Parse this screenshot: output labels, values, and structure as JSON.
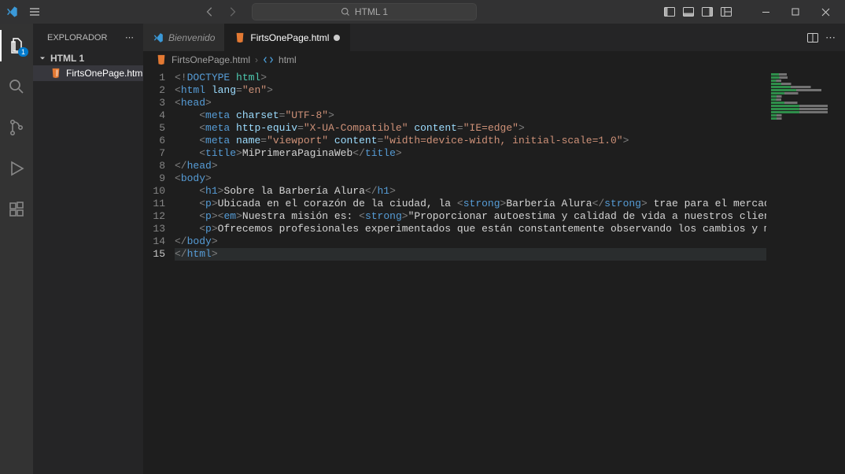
{
  "titlebar": {
    "search_placeholder": "HTML 1"
  },
  "activity": {
    "explorer_badge": "1"
  },
  "sidebar": {
    "title": "EXPLORADOR",
    "folder": "HTML 1",
    "files": [
      {
        "name": "FirtsOnePage.html"
      }
    ]
  },
  "tabs": [
    {
      "id": "welcome",
      "label": "Bienvenido",
      "icon": "vscode",
      "active": false,
      "dirty": false,
      "italic": true
    },
    {
      "id": "file1",
      "label": "FirtsOnePage.html",
      "icon": "html",
      "active": true,
      "dirty": true,
      "italic": false
    }
  ],
  "breadcrumb": {
    "file": "FirtsOnePage.html",
    "symbol": "html"
  },
  "code": {
    "current_line": 15,
    "lines": [
      {
        "n": 1,
        "indent": 0,
        "tokens": [
          [
            "delim",
            "<!"
          ],
          [
            "doctype",
            "DOCTYPE "
          ],
          [
            "doctype-kw",
            "html"
          ],
          [
            "delim",
            ">"
          ]
        ]
      },
      {
        "n": 2,
        "indent": 0,
        "tokens": [
          [
            "delim",
            "<"
          ],
          [
            "tag",
            "html "
          ],
          [
            "attr",
            "lang"
          ],
          [
            "delim",
            "="
          ],
          [
            "str",
            "\"en\""
          ],
          [
            "delim",
            ">"
          ]
        ]
      },
      {
        "n": 3,
        "indent": 0,
        "tokens": [
          [
            "delim",
            "<"
          ],
          [
            "tag",
            "head"
          ],
          [
            "delim",
            ">"
          ]
        ]
      },
      {
        "n": 4,
        "indent": 1,
        "tokens": [
          [
            "delim",
            "<"
          ],
          [
            "tag",
            "meta "
          ],
          [
            "attr",
            "charset"
          ],
          [
            "delim",
            "="
          ],
          [
            "str",
            "\"UTF-8\""
          ],
          [
            "delim",
            ">"
          ]
        ]
      },
      {
        "n": 5,
        "indent": 1,
        "tokens": [
          [
            "delim",
            "<"
          ],
          [
            "tag",
            "meta "
          ],
          [
            "attr",
            "http-equiv"
          ],
          [
            "delim",
            "="
          ],
          [
            "str",
            "\"X-UA-Compatible\" "
          ],
          [
            "attr",
            "content"
          ],
          [
            "delim",
            "="
          ],
          [
            "str",
            "\"IE=edge\""
          ],
          [
            "delim",
            ">"
          ]
        ]
      },
      {
        "n": 6,
        "indent": 1,
        "tokens": [
          [
            "delim",
            "<"
          ],
          [
            "tag",
            "meta "
          ],
          [
            "attr",
            "name"
          ],
          [
            "delim",
            "="
          ],
          [
            "str",
            "\"viewport\" "
          ],
          [
            "attr",
            "content"
          ],
          [
            "delim",
            "="
          ],
          [
            "str",
            "\"width=device-width, initial-scale=1.0\""
          ],
          [
            "delim",
            ">"
          ]
        ]
      },
      {
        "n": 7,
        "indent": 1,
        "tokens": [
          [
            "delim",
            "<"
          ],
          [
            "tag",
            "title"
          ],
          [
            "delim",
            ">"
          ],
          [
            "plain",
            "MiPrimeraPaginaWeb"
          ],
          [
            "delim",
            "</"
          ],
          [
            "tag",
            "title"
          ],
          [
            "delim",
            ">"
          ]
        ]
      },
      {
        "n": 8,
        "indent": 0,
        "tokens": [
          [
            "delim",
            "</"
          ],
          [
            "tag",
            "head"
          ],
          [
            "delim",
            ">"
          ]
        ]
      },
      {
        "n": 9,
        "indent": 0,
        "tokens": [
          [
            "delim",
            "<"
          ],
          [
            "tag",
            "body"
          ],
          [
            "delim",
            ">"
          ]
        ]
      },
      {
        "n": 10,
        "indent": 1,
        "tokens": [
          [
            "delim",
            "<"
          ],
          [
            "tag",
            "h1"
          ],
          [
            "delim",
            ">"
          ],
          [
            "plain",
            "Sobre la Barbería Alura"
          ],
          [
            "delim",
            "</"
          ],
          [
            "tag",
            "h1"
          ],
          [
            "delim",
            ">"
          ]
        ]
      },
      {
        "n": 11,
        "indent": 1,
        "tokens": [
          [
            "delim",
            "<"
          ],
          [
            "tag",
            "p"
          ],
          [
            "delim",
            ">"
          ],
          [
            "plain",
            "Ubicada en el corazón de la ciudad, la "
          ],
          [
            "delim",
            "<"
          ],
          [
            "tag",
            "strong"
          ],
          [
            "delim",
            ">"
          ],
          [
            "plain",
            "Barbería Alura"
          ],
          [
            "delim",
            "</"
          ],
          [
            "tag",
            "strong"
          ],
          [
            "delim",
            ">"
          ],
          [
            "plain",
            " trae para el mercado lo que hay d"
          ]
        ]
      },
      {
        "n": 12,
        "indent": 1,
        "tokens": [
          [
            "delim",
            "<"
          ],
          [
            "tag",
            "p"
          ],
          [
            "delim",
            ">"
          ],
          [
            "delim",
            "<"
          ],
          [
            "tag",
            "em"
          ],
          [
            "delim",
            ">"
          ],
          [
            "plain",
            "Nuestra misión es: "
          ],
          [
            "delim",
            "<"
          ],
          [
            "tag",
            "strong"
          ],
          [
            "delim",
            ">"
          ],
          [
            "plain",
            "\"Proporcionar autoestima y calidad de vida a nuestros clientes\""
          ],
          [
            "delim",
            "</"
          ],
          [
            "tag",
            "strong"
          ],
          [
            "delim",
            ">"
          ],
          [
            "plain",
            "."
          ]
        ]
      },
      {
        "n": 13,
        "indent": 1,
        "tokens": [
          [
            "delim",
            "<"
          ],
          [
            "tag",
            "p"
          ],
          [
            "delim",
            ">"
          ],
          [
            "plain",
            "Ofrecemos profesionales experimentados que están constantemente observando los cambios y movimiento en e"
          ]
        ]
      },
      {
        "n": 14,
        "indent": 0,
        "tokens": [
          [
            "delim",
            "</"
          ],
          [
            "tag",
            "body"
          ],
          [
            "delim",
            ">"
          ]
        ]
      },
      {
        "n": 15,
        "indent": 0,
        "tokens": [
          [
            "delim",
            "</"
          ],
          [
            "tag",
            "html"
          ],
          [
            "delim",
            ">"
          ]
        ]
      }
    ]
  }
}
